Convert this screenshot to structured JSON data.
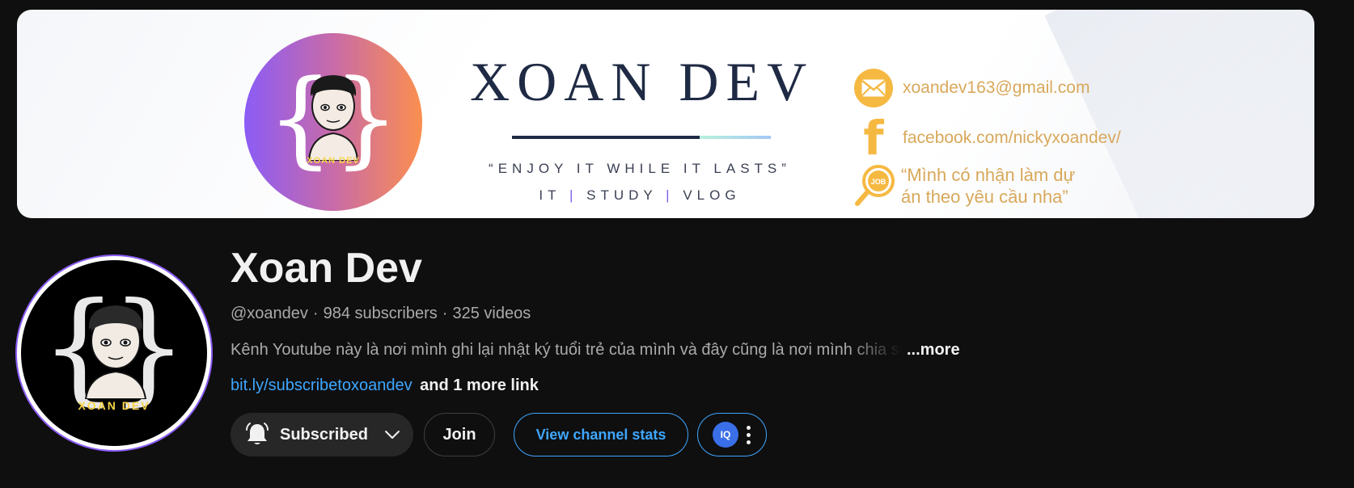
{
  "banner": {
    "logo_text": "XOAN DEV",
    "title": "XOAN DEV",
    "tagline": "“ENJOY IT WHILE IT LASTS”",
    "subline": {
      "part1": "IT",
      "sep1": "|",
      "part2": "STUDY",
      "sep2": "|",
      "part3": "VLOG"
    },
    "email": "xoandev163@gmail.com",
    "facebook": "facebook.com/nickyxoandev/",
    "job_note": "“Mình có nhận làm dự án theo yêu cầu nha”",
    "job_icon_label": "JOB",
    "icons": {
      "email": "envelope-icon",
      "facebook": "facebook-icon",
      "job": "job-search-icon"
    },
    "colors": {
      "title": "#1f2a44",
      "contact": "#d8a85a",
      "icon_bg": "#f5b942",
      "logo_gradient_start": "#8b5cf6",
      "logo_gradient_end": "#fb8f4f"
    }
  },
  "channel": {
    "avatar_text": "XOAN DEV",
    "name": "Xoan Dev",
    "handle": "@xoandev",
    "dot": "·",
    "subscribers": "984 subscribers",
    "videos": "325 videos",
    "description": "Kênh Youtube này là nơi mình ghi lại nhật ký tuổi trẻ của mình và đây cũng là nơi mình chia sẻ",
    "more_label": "...more",
    "link": "bit.ly/subscribetoxoandev",
    "more_links": "and 1 more link"
  },
  "actions": {
    "subscribed_label": "Subscribed",
    "join_label": "Join",
    "stats_label": "View channel stats",
    "iq_label": "IQ",
    "icons": {
      "bell": "bell-icon",
      "chevron": "chevron-down-icon",
      "more": "more-vertical-icon"
    },
    "colors": {
      "accent": "#3ea6ff",
      "subscribed_bg": "#272727"
    }
  }
}
